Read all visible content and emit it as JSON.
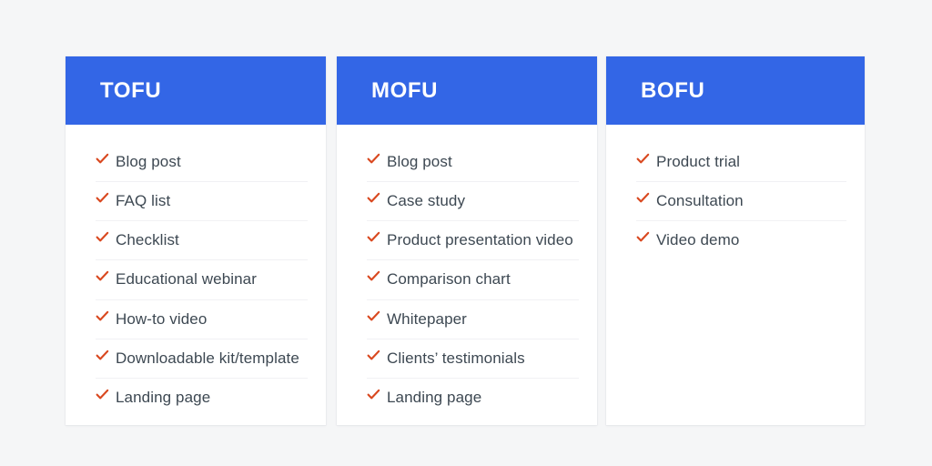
{
  "background_color": "#f5f6f7",
  "theme": {
    "header_blue": "#3366e6",
    "header_text": "#ffffff",
    "check_color": "#d9481f",
    "item_text": "#3d4852",
    "divider": "#f1f1f4",
    "card_background": "#ffffff"
  },
  "check_icon_name": "checkmark-icon",
  "columns": [
    {
      "title": "TOFU",
      "items": [
        "Blog post",
        "FAQ list",
        "Checklist",
        "Educational webinar",
        "How-to video",
        "Downloadable kit/template",
        "Landing page"
      ]
    },
    {
      "title": "MOFU",
      "items": [
        "Blog post",
        "Case study",
        "Product presentation video",
        "Comparison chart",
        "Whitepaper",
        "Clients’ testimonials",
        "Landing page"
      ]
    },
    {
      "title": "BOFU",
      "items": [
        "Product trial",
        "Consultation",
        "Video demo"
      ]
    }
  ]
}
